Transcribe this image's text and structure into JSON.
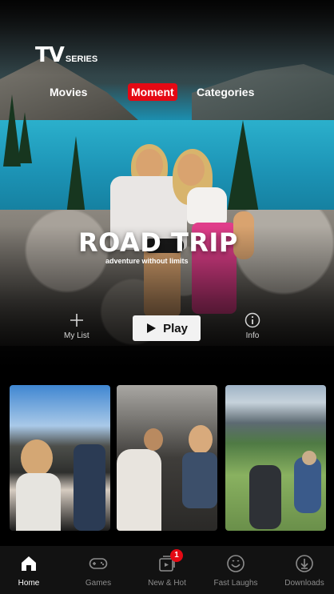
{
  "brand": {
    "tv": "TV",
    "series": "SERIES"
  },
  "topnav": {
    "items": [
      {
        "label": "Movies"
      },
      {
        "label": "Moment",
        "active": true
      },
      {
        "label": "Categories"
      }
    ],
    "active_color": "#e50914"
  },
  "hero": {
    "title": "ROAD TRIP",
    "subtitle": "adventure without limits",
    "actions": {
      "mylist": {
        "label": "My List",
        "icon": "plus-icon"
      },
      "play": {
        "label": "Play",
        "icon": "play-icon"
      },
      "info": {
        "label": "Info",
        "icon": "info-icon"
      }
    }
  },
  "thumbnails": [
    {
      "name": "car-selfie-thumbnail"
    },
    {
      "name": "car-backseat-thumbnail"
    },
    {
      "name": "mountain-hike-thumbnail"
    }
  ],
  "bottomnav": {
    "tabs": [
      {
        "label": "Home",
        "icon": "home-icon",
        "active": true
      },
      {
        "label": "Games",
        "icon": "gamepad-icon"
      },
      {
        "label": "New & Hot",
        "icon": "new-hot-icon",
        "badge": "1"
      },
      {
        "label": "Fast Laughs",
        "icon": "smiley-icon"
      },
      {
        "label": "Downloads",
        "icon": "download-icon"
      }
    ]
  }
}
